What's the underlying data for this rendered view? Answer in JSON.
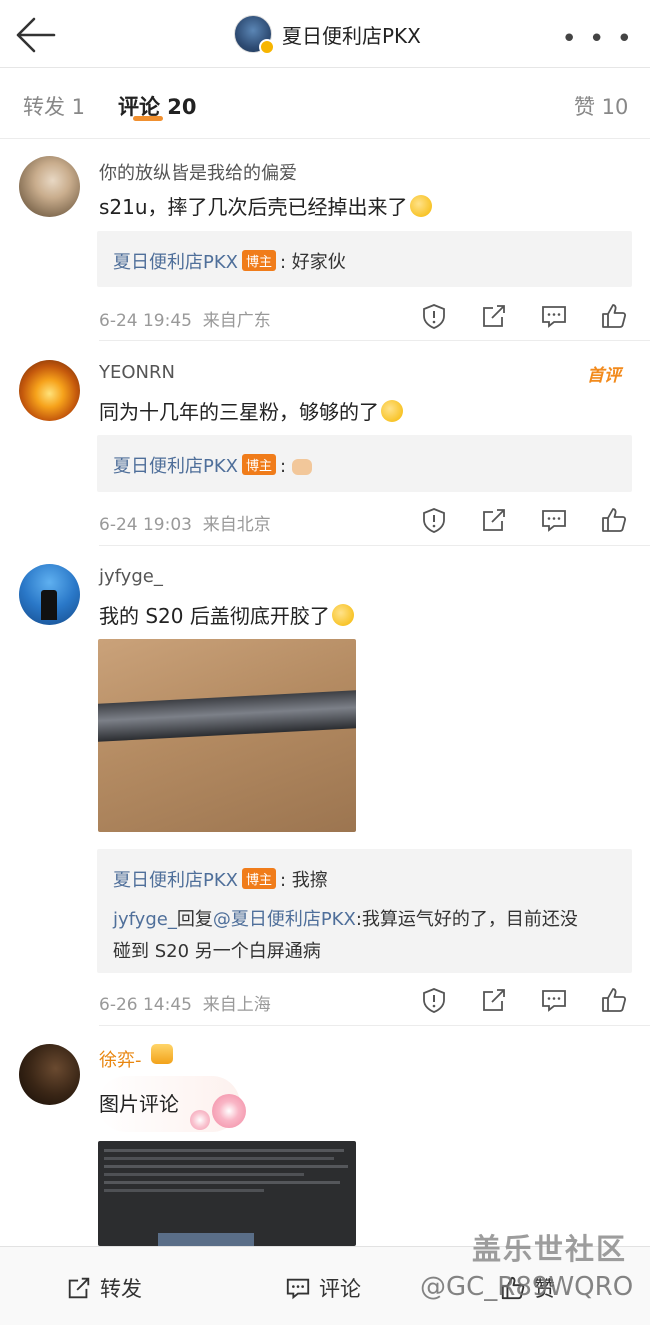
{
  "header": {
    "title": "夏日便利店PKX",
    "more": "• • •"
  },
  "tabs": [
    {
      "label": "转发 1"
    },
    {
      "label": "评论 20"
    },
    {
      "label": "赞 10"
    }
  ],
  "comments": [
    {
      "username": "你的放纵皆是我给的偏爱",
      "text": "s21u，摔了几次后壳已经掉出来了",
      "reply": [
        {
          "name": "夏日便利店PKX",
          "badge": "博主",
          "text": ": 好家伙"
        }
      ],
      "time": "6-24 19:45",
      "source": "来自广东"
    },
    {
      "username": "YEONRN",
      "first_badge": "首评",
      "text": "同为十几年的三星粉，够够的了",
      "reply": [
        {
          "name": "夏日便利店PKX",
          "badge": "博主",
          "text": ":"
        }
      ],
      "time": "6-24 19:03",
      "source": "来自北京"
    },
    {
      "username": "jyfyge_",
      "text": "我的 S20 后盖彻底开胶了",
      "reply": [
        {
          "name": "夏日便利店PKX",
          "badge": "博主",
          "text": ": 我擦"
        },
        {
          "name": "jyfyge_",
          "mid": "回复",
          "mention": "@夏日便利店PKX",
          "text": ":我算运气好的了，目前还没"
        },
        {
          "text": "碰到 S20 另一个白屏通病"
        }
      ],
      "time": "6-26 14:45",
      "source": "来自上海"
    },
    {
      "username": "徐弈-",
      "text": "图片评论"
    }
  ],
  "bottom_bar": {
    "repost": "转发",
    "comment": "评论",
    "like": "赞"
  },
  "watermark": {
    "brand": "盖乐世社区",
    "handle": "@GC_R89WQRO"
  },
  "colors": {
    "accent": "#f09030",
    "link": "#4f6f9a",
    "host_badge": "#f07c1a"
  }
}
